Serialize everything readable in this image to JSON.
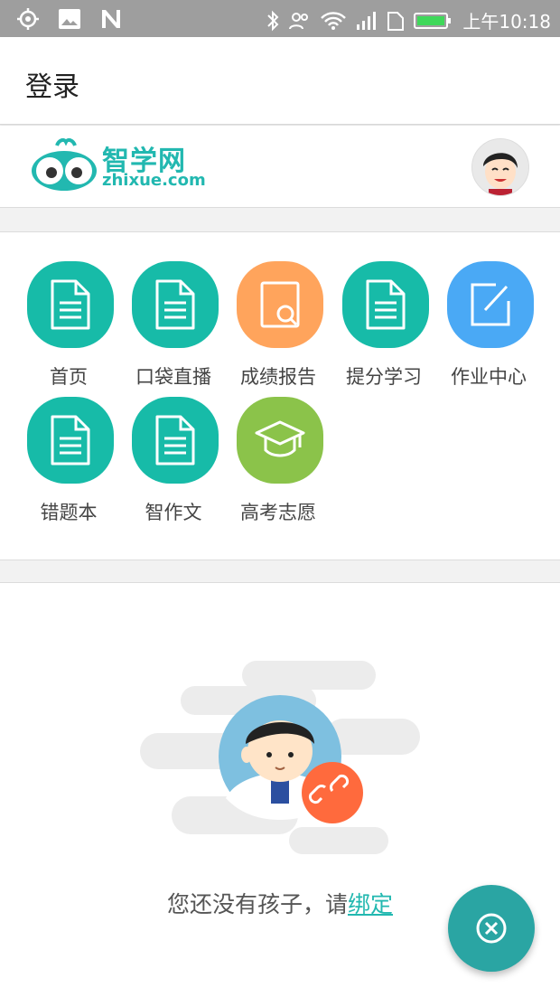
{
  "status_bar": {
    "time": "上午10:18"
  },
  "app_bar": {
    "title": "登录"
  },
  "brand": {
    "name": "智学网",
    "url": "zhixue.com"
  },
  "menu": {
    "items": [
      {
        "label": "首页",
        "icon": "document-icon",
        "color": "#17bba8"
      },
      {
        "label": "口袋直播",
        "icon": "document-icon",
        "color": "#17bba8"
      },
      {
        "label": "成绩报告",
        "icon": "report-search-icon",
        "color": "#ffa45c"
      },
      {
        "label": "提分学习",
        "icon": "document-icon",
        "color": "#17bba8"
      },
      {
        "label": "作业中心",
        "icon": "edit-icon",
        "color": "#4aa9f5"
      },
      {
        "label": "错题本",
        "icon": "document-icon",
        "color": "#17bba8"
      },
      {
        "label": "智作文",
        "icon": "document-icon",
        "color": "#17bba8"
      },
      {
        "label": "高考志愿",
        "icon": "graduation-cap-icon",
        "color": "#8bc34a"
      }
    ]
  },
  "empty_state": {
    "message": "您还没有孩子，请",
    "link": "绑定"
  },
  "colors": {
    "accent": "#22b8b0",
    "fab": "#2aa5a3",
    "link_badge": "#ff6a3d"
  }
}
